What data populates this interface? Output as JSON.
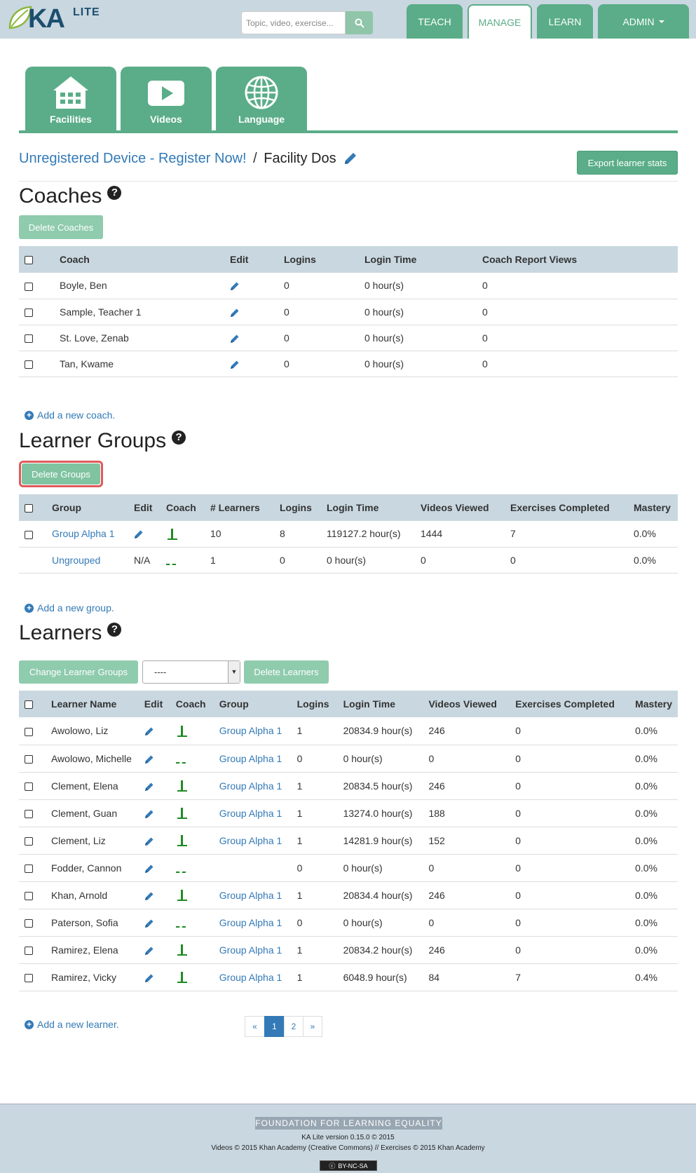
{
  "header": {
    "logo_ka": "KA",
    "logo_lite": "LITE",
    "search_placeholder": "Topic, video, exercise...",
    "nav": {
      "teach": "TEACH",
      "manage": "MANAGE",
      "learn": "LEARN",
      "admin": "ADMIN"
    }
  },
  "manage_tabs": {
    "facilities": "Facilities",
    "videos": "Videos",
    "language": "Language"
  },
  "breadcrumb": {
    "register": "Unregistered Device - Register Now!",
    "separator": "/",
    "facility": "Facility Dos"
  },
  "export_button": "Export learner stats",
  "coaches": {
    "title": "Coaches",
    "delete_button": "Delete Coaches",
    "columns": [
      "Coach",
      "Edit",
      "Logins",
      "Login Time",
      "Coach Report Views"
    ],
    "rows": [
      {
        "name": "Boyle, Ben",
        "logins": "0",
        "login_time": "0 hour(s)",
        "views": "0"
      },
      {
        "name": "Sample, Teacher 1",
        "logins": "0",
        "login_time": "0 hour(s)",
        "views": "0"
      },
      {
        "name": "St. Love, Zenab",
        "logins": "0",
        "login_time": "0 hour(s)",
        "views": "0"
      },
      {
        "name": "Tan, Kwame",
        "logins": "0",
        "login_time": "0 hour(s)",
        "views": "0"
      }
    ],
    "add_link": "Add a new coach."
  },
  "groups": {
    "title": "Learner Groups",
    "delete_button": "Delete Groups",
    "columns": [
      "Group",
      "Edit",
      "Coach",
      "# Learners",
      "Logins",
      "Login Time",
      "Videos Viewed",
      "Exercises Completed",
      "Mastery"
    ],
    "rows": [
      {
        "name": "Group Alpha 1",
        "edit": "",
        "learners": "10",
        "logins": "8",
        "login_time": "119127.2 hour(s)",
        "videos": "1444",
        "exercises": "7",
        "mastery": "0.0%"
      },
      {
        "name": "Ungrouped",
        "edit": "N/A",
        "learners": "1",
        "logins": "0",
        "login_time": "0 hour(s)",
        "videos": "0",
        "exercises": "0",
        "mastery": "0.0%"
      }
    ],
    "add_link": "Add a new group."
  },
  "learners": {
    "title": "Learners",
    "change_button": "Change Learner Groups",
    "select_value": "----",
    "delete_button": "Delete Learners",
    "columns": [
      "Learner Name",
      "Edit",
      "Coach",
      "Group",
      "Logins",
      "Login Time",
      "Videos Viewed",
      "Exercises Completed",
      "Mastery"
    ],
    "rows": [
      {
        "name": "Awolowo, Liz",
        "active": true,
        "group": "Group Alpha 1",
        "logins": "1",
        "login_time": "20834.9 hour(s)",
        "videos": "246",
        "exercises": "0",
        "mastery": "0.0%"
      },
      {
        "name": "Awolowo, Michelle",
        "active": false,
        "group": "Group Alpha 1",
        "logins": "0",
        "login_time": "0 hour(s)",
        "videos": "0",
        "exercises": "0",
        "mastery": "0.0%"
      },
      {
        "name": "Clement, Elena",
        "active": true,
        "group": "Group Alpha 1",
        "logins": "1",
        "login_time": "20834.5 hour(s)",
        "videos": "246",
        "exercises": "0",
        "mastery": "0.0%"
      },
      {
        "name": "Clement, Guan",
        "active": true,
        "group": "Group Alpha 1",
        "logins": "1",
        "login_time": "13274.0 hour(s)",
        "videos": "188",
        "exercises": "0",
        "mastery": "0.0%"
      },
      {
        "name": "Clement, Liz",
        "active": true,
        "group": "Group Alpha 1",
        "logins": "1",
        "login_time": "14281.9 hour(s)",
        "videos": "152",
        "exercises": "0",
        "mastery": "0.0%"
      },
      {
        "name": "Fodder, Cannon",
        "active": false,
        "group": "",
        "logins": "0",
        "login_time": "0 hour(s)",
        "videos": "0",
        "exercises": "0",
        "mastery": "0.0%"
      },
      {
        "name": "Khan, Arnold",
        "active": true,
        "group": "Group Alpha 1",
        "logins": "1",
        "login_time": "20834.4 hour(s)",
        "videos": "246",
        "exercises": "0",
        "mastery": "0.0%"
      },
      {
        "name": "Paterson, Sofia",
        "active": false,
        "group": "Group Alpha 1",
        "logins": "0",
        "login_time": "0 hour(s)",
        "videos": "0",
        "exercises": "0",
        "mastery": "0.0%"
      },
      {
        "name": "Ramirez, Elena",
        "active": true,
        "group": "Group Alpha 1",
        "logins": "1",
        "login_time": "20834.2 hour(s)",
        "videos": "246",
        "exercises": "0",
        "mastery": "0.0%"
      },
      {
        "name": "Ramirez, Vicky",
        "active": true,
        "group": "Group Alpha 1",
        "logins": "1",
        "login_time": "6048.9 hour(s)",
        "videos": "84",
        "exercises": "7",
        "mastery": "0.4%"
      }
    ],
    "add_link": "Add a new learner."
  },
  "pagination": {
    "prev": "«",
    "pages": [
      "1",
      "2"
    ],
    "current": "1",
    "next": "»"
  },
  "footer": {
    "org": "FOUNDATION FOR LEARNING EQUALITY",
    "version": "KA Lite version 0.15.0 © 2015",
    "credits": "Videos © 2015 Khan Academy (Creative Commons) // Exercises © 2015 Khan Academy",
    "license": "BY-NC-SA"
  },
  "colors": {
    "green": "#5aad88",
    "light_green": "#8fcbad",
    "header_bg": "#c9d7e0",
    "link": "#337ab7",
    "highlight": "#e05a5a"
  }
}
